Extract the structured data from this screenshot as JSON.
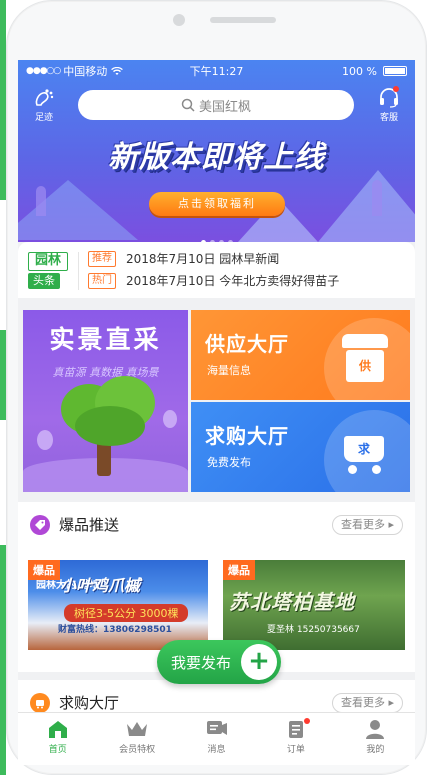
{
  "status_bar": {
    "signal": "●●●○○",
    "carrier": "中国移动",
    "time": "下午11:27",
    "battery": "100 %"
  },
  "header": {
    "left_label": "足迹",
    "right_label": "客服",
    "search_placeholder": "美国红枫"
  },
  "banner": {
    "headline": "新版本即将上线",
    "cta": "点击领取福利",
    "page_count": 4,
    "active_page": 1
  },
  "news": {
    "logo_top": "园林",
    "logo_bottom": "头条",
    "items": [
      {
        "tag": "推荐",
        "text": "2018年7月10日 园林早新闻"
      },
      {
        "tag": "热门",
        "text": "2018年7月10日 今年北方卖得好得苗子"
      }
    ]
  },
  "features": {
    "big": {
      "title": "实景直采",
      "subtitle": "真苗源 真数据 真场景"
    },
    "supply": {
      "title": "供应大厅",
      "subtitle": "海量信息",
      "icon_text": "供"
    },
    "demand": {
      "title": "求购大厅",
      "subtitle": "免费发布",
      "icon_text": "求"
    }
  },
  "hot": {
    "title": "爆品推送",
    "more": "查看更多",
    "cards": [
      {
        "badge": "爆品",
        "top_line": "园林大的 基地",
        "title": "小叶鸡爪槭",
        "price": "树径3-5公分 3000棵",
        "phone": "财富热线：13806298501"
      },
      {
        "badge": "爆品",
        "title": "苏北塔柏基地",
        "phone": "夏圣林 15250735667"
      }
    ]
  },
  "demand_section": {
    "title": "求购大厅",
    "more": "查看更多"
  },
  "publish_button": {
    "label": "我要发布",
    "plus": "+"
  },
  "tabbar": [
    {
      "label": "首页",
      "icon": "home-icon",
      "active": true
    },
    {
      "label": "会员特权",
      "icon": "crown-icon",
      "active": false
    },
    {
      "label": "消息",
      "icon": "message-icon",
      "active": false
    },
    {
      "label": "订单",
      "icon": "order-icon",
      "active": false,
      "notification": true
    },
    {
      "label": "我的",
      "icon": "user-icon",
      "active": false
    }
  ],
  "colors": {
    "brand_green": "#2fae4a",
    "banner_blue": "#4b84f1",
    "supply_orange": "#ff7a1d",
    "demand_blue": "#2a6fe8",
    "big_tile_purple": "#8b5ae8",
    "tag_orange": "#ff7a2f"
  }
}
